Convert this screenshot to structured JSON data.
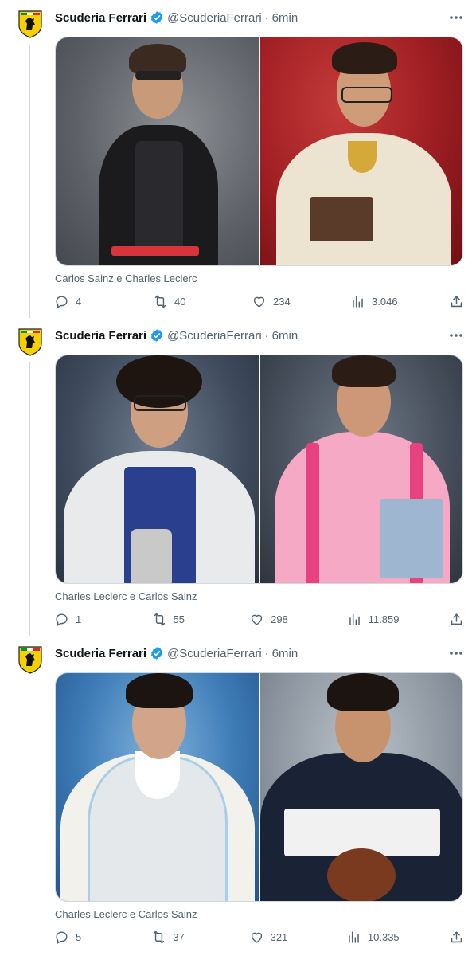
{
  "tweets": [
    {
      "author": {
        "name": "Scuderia Ferrari",
        "handle": "@ScuderiaFerrari",
        "dot": "·",
        "time": "6min",
        "avatar": "ferrari-shield-icon"
      },
      "caption": "Carlos Sainz e Charles Leclerc",
      "stats": {
        "replies": "4",
        "retweets": "40",
        "likes": "234",
        "views": "3.046"
      },
      "photos": [
        "portrait photo: man in sunglasses and black leather jacket, grey backdrop",
        "portrait photo: man in glasses holding book, red backdrop"
      ]
    },
    {
      "author": {
        "name": "Scuderia Ferrari",
        "handle": "@ScuderiaFerrari",
        "dot": "·",
        "time": "6min",
        "avatar": "ferrari-shield-icon"
      },
      "caption": "Charles Leclerc e Carlos Sainz",
      "stats": {
        "replies": "1",
        "retweets": "55",
        "likes": "298",
        "views": "11.859"
      },
      "photos": [
        "portrait photo: curly-haired man in lab coat holding trophy",
        "portrait photo: man in pink turtleneck holding book"
      ]
    },
    {
      "author": {
        "name": "Scuderia Ferrari",
        "handle": "@ScuderiaFerrari",
        "dot": "·",
        "time": "6min",
        "avatar": "ferrari-shield-icon"
      },
      "caption": "Charles Leclerc e Carlos Sainz",
      "stats": {
        "replies": "5",
        "retweets": "37",
        "likes": "321",
        "views": "10.335"
      },
      "photos": [
        "portrait photo: man in white knit vest, blue backdrop",
        "portrait photo: man in football jersey holding football"
      ]
    }
  ],
  "colors": {
    "text": "#0f1419",
    "muted": "#536471",
    "verified": "#1d9bf0",
    "ferrari_yellow": "#f6d000",
    "ferrari_red": "#d40000"
  }
}
